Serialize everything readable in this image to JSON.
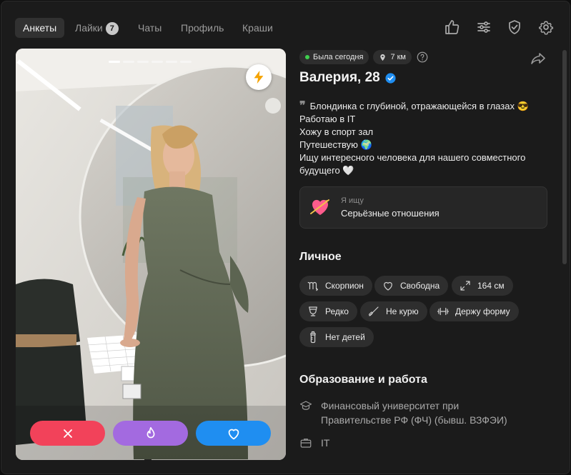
{
  "nav": {
    "tabs": [
      {
        "label": "Анкеты",
        "active": true
      },
      {
        "label": "Лайки",
        "badge": "7"
      },
      {
        "label": "Чаты"
      },
      {
        "label": "Профиль"
      },
      {
        "label": "Краши"
      }
    ],
    "icons": [
      "thumbs-up-icon",
      "sliders-icon",
      "shield-check-icon",
      "gear-icon"
    ]
  },
  "photo": {
    "pager_count": 6,
    "pager_active": 0,
    "actions": [
      "dislike",
      "superlike",
      "like"
    ],
    "colors": {
      "dislike": "#f2425a",
      "superlike": "#a36ae0",
      "like": "#1f8ef1"
    }
  },
  "profile": {
    "last_seen": "Была сегодня",
    "distance": "7 км",
    "name": "Валерия, 28",
    "bio": [
      "Блондинка с глубиной, отражающейся в глазах 😎",
      "Работаю в IT",
      "Хожу в спорт зал",
      "Путешествую 🌍",
      "Ищу интересного человека для нашего совместного",
      "будущего 🤍"
    ],
    "seeking": {
      "label": "Я ищу",
      "value": "Серьёзные отношения"
    }
  },
  "personal": {
    "title": "Личное",
    "chips": [
      {
        "icon": "scorpio-icon",
        "label": "Скорпион"
      },
      {
        "icon": "heart-outline-icon",
        "label": "Свободна"
      },
      {
        "icon": "height-icon",
        "label": "164 см"
      },
      {
        "icon": "glass-icon",
        "label": "Редко"
      },
      {
        "icon": "no-smoking-icon",
        "label": "Не курю"
      },
      {
        "icon": "dumbbell-icon",
        "label": "Держу форму"
      },
      {
        "icon": "baby-bottle-icon",
        "label": "Нет детей"
      }
    ]
  },
  "education": {
    "title": "Образование и работа",
    "university": [
      "Финансовый университет при",
      "Правительстве РФ (ФЧ) (бывш. ВЗФЭИ)"
    ],
    "job": "IT"
  }
}
